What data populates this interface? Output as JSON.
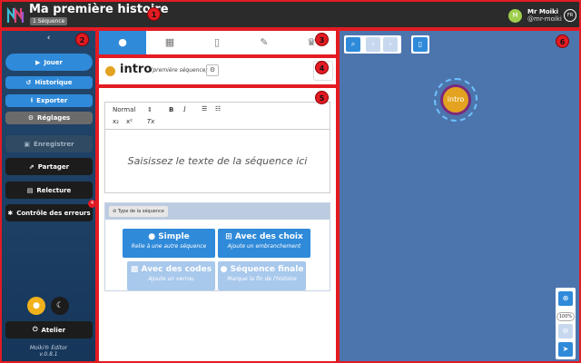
{
  "header": {
    "title": "Ma première histoire",
    "sequence_badge": "1 Séquence",
    "user_initial": "M",
    "user_name": "Mr Moiki",
    "user_handle": "@mr-moiki",
    "language": "FR"
  },
  "markers": [
    "1",
    "2",
    "3",
    "4",
    "5",
    "6"
  ],
  "sidebar": {
    "collapse_icon": "chevron-left-icon",
    "buttons": {
      "play": "Jouer",
      "history": "Historique",
      "export": "Exporter",
      "settings": "Réglages",
      "save": "Enregistrer",
      "share": "Partager",
      "proofread": "Relecture",
      "error_check": "Contrôle des erreurs",
      "workshop": "Atelier"
    },
    "error_count": "4",
    "footer_name": "Moiki® Editor",
    "footer_version": "v.0.8.1"
  },
  "tabs": [
    "map-pin-icon",
    "calculator-icon",
    "file-icon",
    "brush-icon",
    "trophy-icon"
  ],
  "sequence": {
    "name": "intro",
    "subtitle": "(première séquence)"
  },
  "editor": {
    "format_select": "Normal",
    "bold": "B",
    "italic": "I",
    "subscript": "x₂",
    "superscript": "x²",
    "clear_format": "Tx",
    "placeholder": "Saisissez le texte de la séquence ici"
  },
  "sequence_type": {
    "label": "Type de la séquence",
    "options": [
      {
        "title": "Simple",
        "subtitle": "Relie à une autre séquence"
      },
      {
        "title": "Avec des choix",
        "subtitle": "Ajoute un embranchement"
      },
      {
        "title": "Avec des codes",
        "subtitle": "Ajoute un verrou"
      },
      {
        "title": "Séquence finale",
        "subtitle": "Marque la fin de l'histoire"
      }
    ]
  },
  "canvas": {
    "node_label": "intro",
    "zoom_level": "100%"
  },
  "colors": {
    "accent_blue": "#2f8ad9",
    "node_fill": "#e3a320",
    "node_border": "#7b2a7e",
    "canvas_bg": "#4d75ad",
    "marker_red": "#e31b23"
  }
}
